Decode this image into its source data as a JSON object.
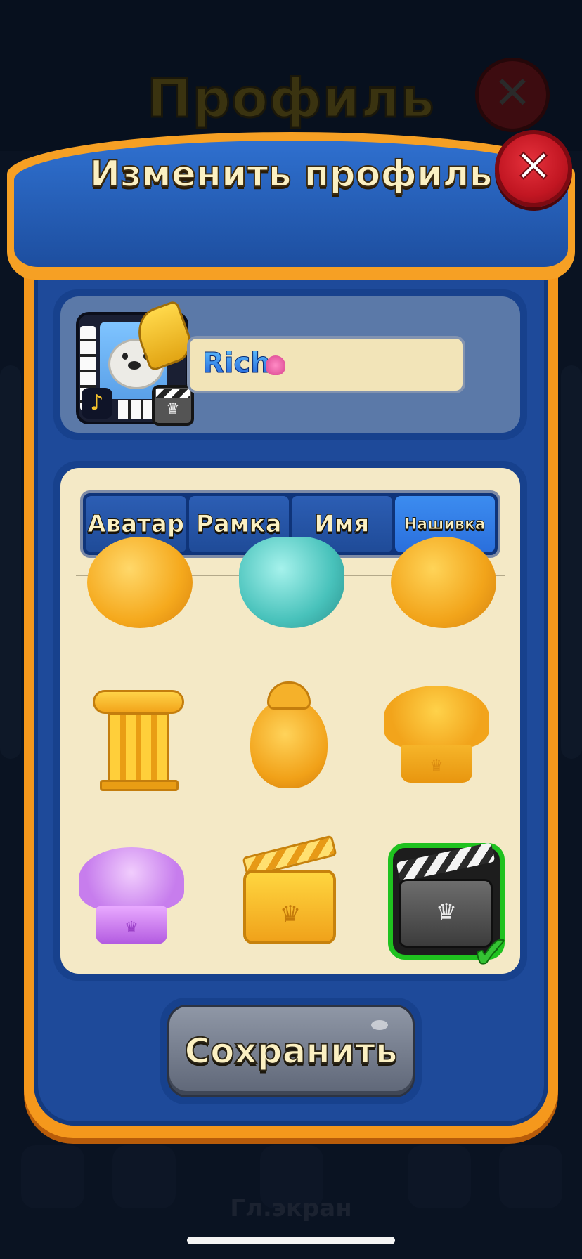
{
  "background": {
    "title": "Профиль",
    "bottom_label": "Гл.экран"
  },
  "dialog": {
    "title": "Изменить профиль",
    "close_icon": "close-icon"
  },
  "profile": {
    "name": "Rich",
    "avatar_icon": "polar-bear-piano-avatar",
    "badge_icon": "clapperboard-silver-badge"
  },
  "tabs": [
    {
      "label": "Аватар",
      "active": false
    },
    {
      "label": "Рамка",
      "active": false
    },
    {
      "label": "Имя",
      "active": false
    },
    {
      "label": "Нашивка",
      "active": true
    }
  ],
  "items": [
    {
      "name": "gold-gem-coin",
      "selected": false
    },
    {
      "name": "teal-diamond",
      "selected": false
    },
    {
      "name": "gold-crown-coin",
      "selected": false
    },
    {
      "name": "gold-pillar",
      "selected": false
    },
    {
      "name": "gold-penguin",
      "selected": false
    },
    {
      "name": "gold-chef-hat",
      "selected": false
    },
    {
      "name": "purple-chef-hat",
      "selected": false
    },
    {
      "name": "gold-clapperboard",
      "selected": false
    },
    {
      "name": "silver-clapperboard",
      "selected": true
    }
  ],
  "save_button": {
    "label": "Сохранить"
  },
  "colors": {
    "modal_border": "#f5981c",
    "modal_fill": "#1e4a9a",
    "selected_outline": "#1fc21f",
    "close_red": "#c21622"
  }
}
